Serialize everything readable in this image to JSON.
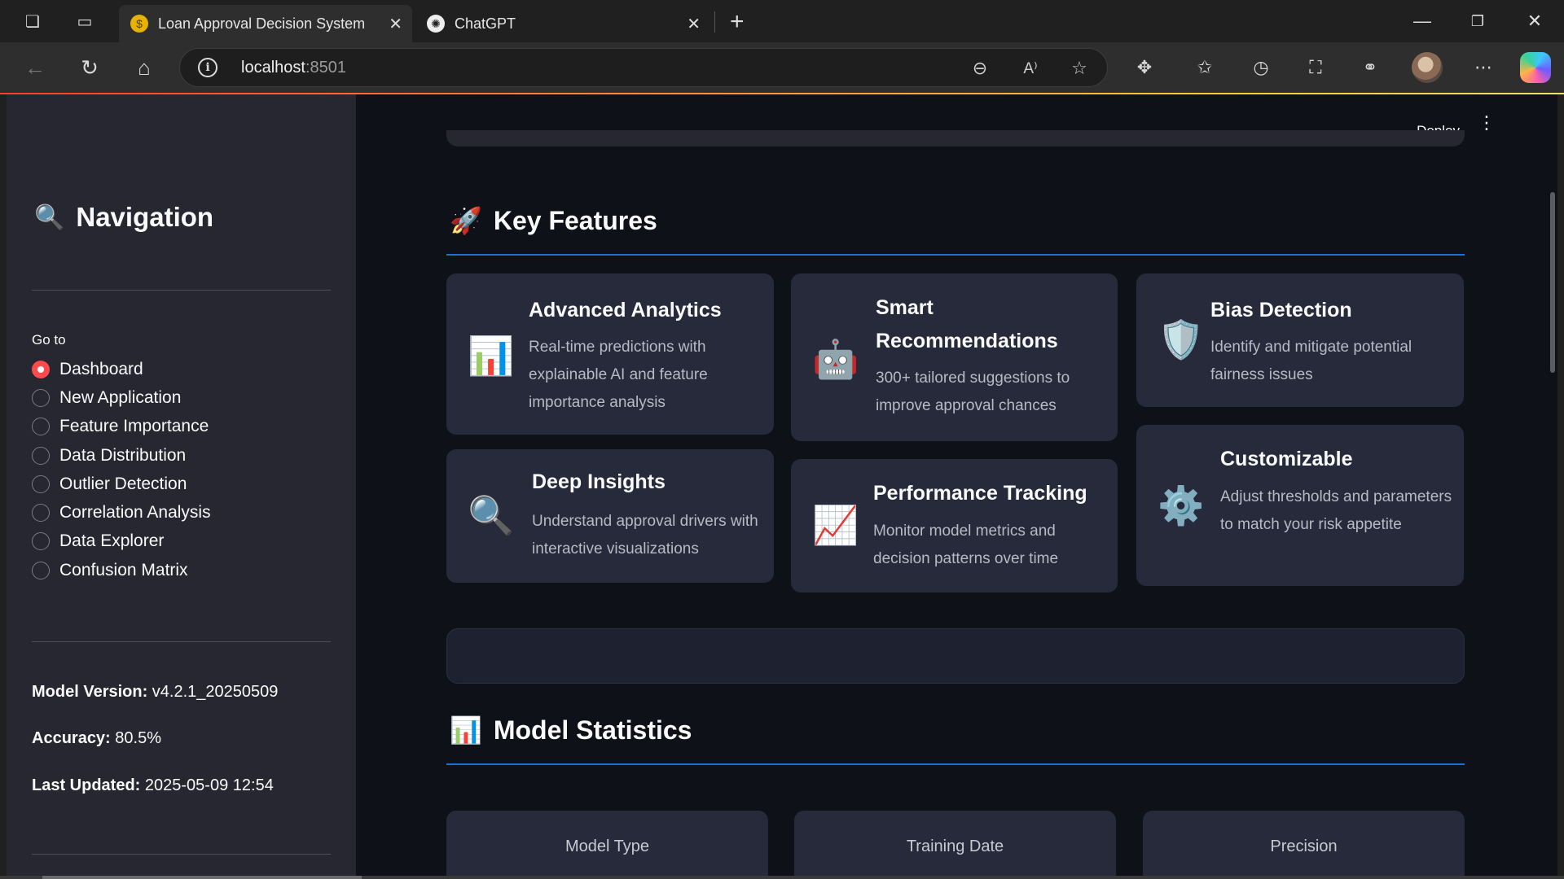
{
  "browser": {
    "tabs": [
      {
        "title": "Loan Approval Decision System",
        "favicon": "money-bag-icon",
        "active": true
      },
      {
        "title": "ChatGPT",
        "favicon": "openai-icon",
        "active": false
      }
    ],
    "url_host": "localhost",
    "url_port": ":8501"
  },
  "sidebar": {
    "title": "Navigation",
    "title_icon": "magnifier-icon",
    "goto_label": "Go to",
    "options": [
      {
        "label": "Dashboard",
        "selected": true
      },
      {
        "label": "New Application",
        "selected": false
      },
      {
        "label": "Feature Importance",
        "selected": false
      },
      {
        "label": "Data Distribution",
        "selected": false
      },
      {
        "label": "Outlier Detection",
        "selected": false
      },
      {
        "label": "Correlation Analysis",
        "selected": false
      },
      {
        "label": "Data Explorer",
        "selected": false
      },
      {
        "label": "Confusion Matrix",
        "selected": false
      }
    ],
    "model_version_label": "Model Version:",
    "model_version_value": " v4.2.1_20250509",
    "accuracy_label": "Accuracy:",
    "accuracy_value": " 80.5%",
    "last_updated_label": "Last Updated:",
    "last_updated_value": " 2025-05-09 12:54"
  },
  "header": {
    "deploy_label": "Deploy"
  },
  "features": {
    "title": "Key Features",
    "title_icon": "rocket-icon",
    "cards": [
      {
        "title": "Advanced Analytics",
        "desc": "Real-time predictions with explainable AI and feature importance analysis",
        "icon": "bar-chart-icon"
      },
      {
        "title": "Smart Recommendations",
        "desc": "300+ tailored suggestions to improve approval chances",
        "icon": "robot-icon"
      },
      {
        "title": "Bias Detection",
        "desc": "Identify and mitigate potential fairness issues",
        "icon": "shield-icon"
      },
      {
        "title": "Deep Insights",
        "desc": "Understand approval drivers with interactive visualizations",
        "icon": "magnifier-icon"
      },
      {
        "title": "Performance Tracking",
        "desc": "Monitor model metrics and decision patterns over time",
        "icon": "trend-chart-icon"
      },
      {
        "title": "Customizable",
        "desc": "Adjust thresholds and parameters to match your risk appetite",
        "icon": "gear-icon"
      }
    ]
  },
  "statistics": {
    "title": "Model Statistics",
    "title_icon": "bar-chart-icon",
    "cards": [
      {
        "label": "Model Type"
      },
      {
        "label": "Training Date"
      },
      {
        "label": "Precision"
      }
    ]
  },
  "colors": {
    "accent_red": "#ff4b4b",
    "section_rule": "#1f6fd1",
    "sidebar_bg": "#262730",
    "main_bg": "#0e1117",
    "card_bg": "#262a3a"
  }
}
